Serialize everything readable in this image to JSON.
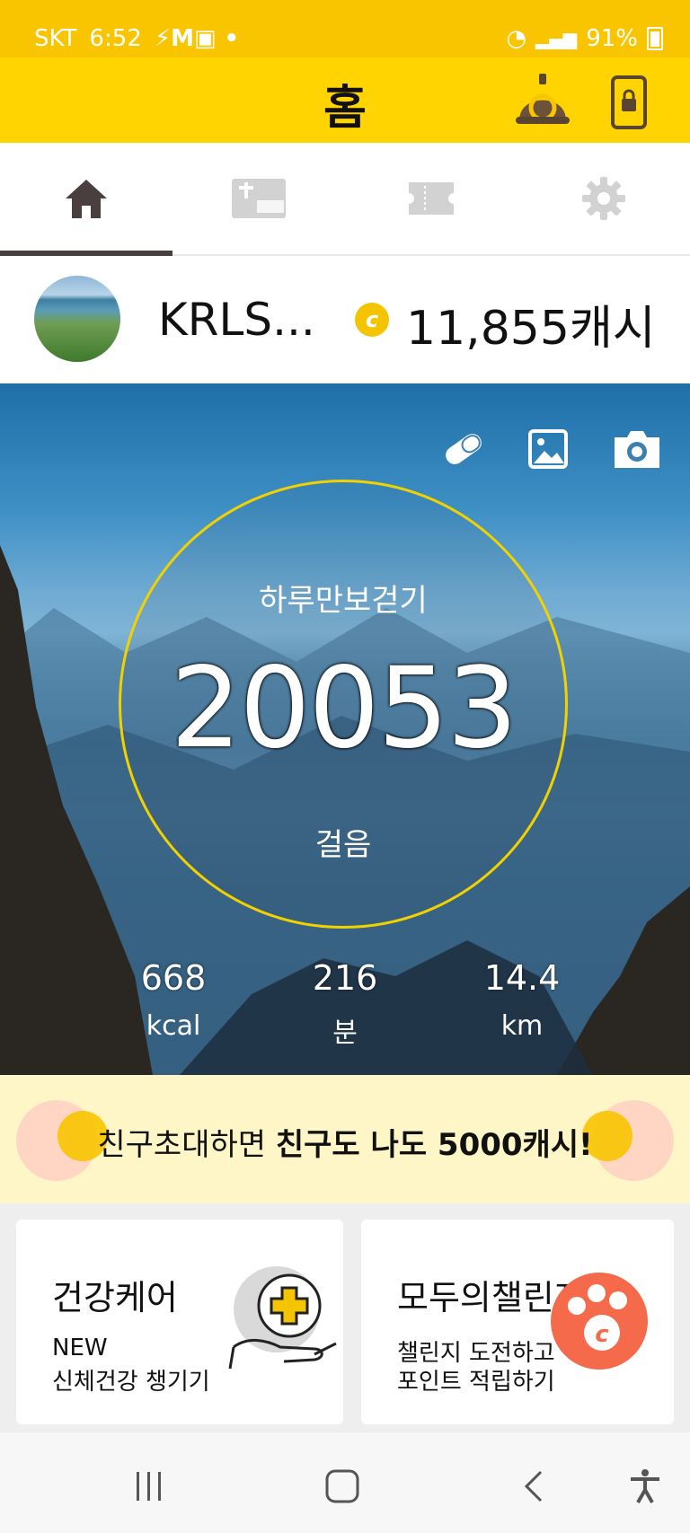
{
  "status_bar": {
    "carrier": "SKT",
    "time": "6:52",
    "battery": "91%"
  },
  "header": {
    "title": "홈"
  },
  "tabs": [
    {
      "name": "home",
      "icon": "home-icon"
    },
    {
      "name": "gift",
      "icon": "gift-card-icon"
    },
    {
      "name": "coupon",
      "icon": "ticket-icon"
    },
    {
      "name": "settings",
      "icon": "gear-icon"
    }
  ],
  "profile": {
    "nickname": "KRLS...",
    "coin_symbol": "c",
    "cash": "11,855캐시"
  },
  "steps": {
    "label": "하루만보걷기",
    "count": "20053",
    "unit": "걸음"
  },
  "stats": [
    {
      "value": "668",
      "unit": "kcal"
    },
    {
      "value": "216",
      "unit": "분"
    },
    {
      "value": "14.4",
      "unit": "km"
    }
  ],
  "invite": {
    "text_normal": "친구초대하면 ",
    "text_bold": "친구도 나도 5000캐시!"
  },
  "cards": {
    "health": {
      "title": "건강케어",
      "line1": "NEW",
      "line2": "신체건강 챙기기"
    },
    "challenge": {
      "title": "모두의챌린지",
      "line1": "챌린지 도전하고",
      "line2": "포인트 적립하기"
    }
  },
  "colors": {
    "header_yellow": "#ffd400",
    "status_yellow": "#f9c400",
    "ring": "#f2d100",
    "challenge_orange": "#f46a4a"
  }
}
